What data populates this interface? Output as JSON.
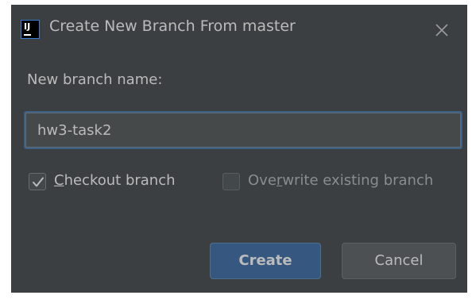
{
  "dialog": {
    "title": "Create New Branch From master",
    "field_label": "New branch name:",
    "branch_name_value": "hw3-task2",
    "checkout": {
      "label_mnemonic": "C",
      "label_rest": "heckout branch",
      "checked": true
    },
    "overwrite": {
      "label_before": "Ove",
      "label_mnemonic": "r",
      "label_after": "write existing branch",
      "checked": false
    },
    "create_button": "Create",
    "cancel_button": "Cancel"
  },
  "icons": {
    "app": "intellij-idea-icon",
    "close": "close-icon",
    "checkmark": "checkmark-icon"
  },
  "colors": {
    "dialog_bg": "#3c3f41",
    "text": "#bbbbbb",
    "disabled_text": "#8a8d8f",
    "input_focus_border": "#3d6185",
    "primary_button_bg": "#365880",
    "secondary_button_bg": "#4c5052"
  }
}
